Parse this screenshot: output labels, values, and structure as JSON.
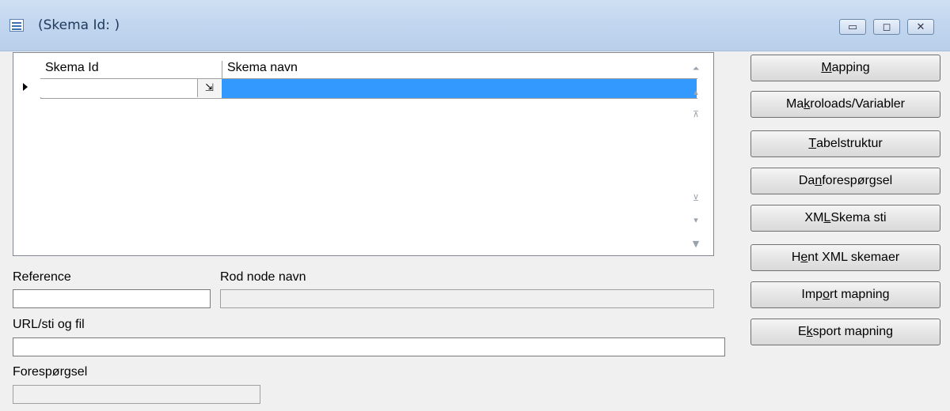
{
  "window": {
    "title": "(Skema Id: )",
    "minimize_glyph": "▭",
    "maximize_glyph": "◻",
    "close_glyph": "✕"
  },
  "grid": {
    "columns": [
      "Skema Id",
      "Skema navn"
    ],
    "rows": [
      {
        "skema_id": "",
        "skema_navn": ""
      }
    ],
    "combo_glyph": "⇲",
    "nav_icons": [
      "first-record-icon",
      "previous-page-icon",
      "previous-record-icon",
      "next-record-icon",
      "next-page-icon",
      "last-record-icon"
    ],
    "selection_color": "#3399ff"
  },
  "fields": {
    "reference": {
      "label": "Reference",
      "value": ""
    },
    "rod_node_navn": {
      "label": "Rod node navn",
      "value": ""
    },
    "url": {
      "label": "URL/sti og fil",
      "value": ""
    },
    "forespoergsel": {
      "label": "Forespørgsel",
      "value": ""
    }
  },
  "buttons": {
    "mapping": {
      "pre": "",
      "key": "M",
      "post": "apping"
    },
    "makroloads": {
      "pre": "Ma",
      "key": "k",
      "post": "roloads/Variabler"
    },
    "tabelstruktur": {
      "pre": "",
      "key": "T",
      "post": "abelstruktur"
    },
    "dan_forespoergsel": {
      "pre": "Da",
      "key": "n",
      "post": " forespørgsel"
    },
    "xml_skema_sti": {
      "pre": "XM",
      "key": "L",
      "post": " Skema sti"
    },
    "hent_xml": {
      "pre": "H",
      "key": "e",
      "post": "nt XML skemaer"
    },
    "import_mapning": {
      "pre": "Imp",
      "key": "o",
      "post": "rt mapning"
    },
    "eksport_mapning": {
      "pre": "E",
      "key": "k",
      "post": "sport mapning"
    }
  }
}
